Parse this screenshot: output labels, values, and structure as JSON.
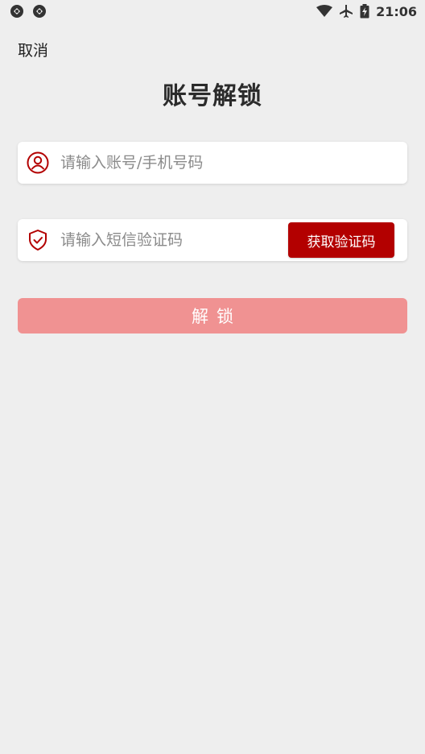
{
  "status_bar": {
    "time": "21:06",
    "icons": [
      "sync-icon",
      "sync-icon",
      "wifi-icon",
      "airplane-icon",
      "battery-icon"
    ]
  },
  "header": {
    "cancel_label": "取消",
    "title": "账号解锁"
  },
  "form": {
    "account": {
      "placeholder": "请输入账号/手机号码",
      "value": "",
      "icon": "user-icon"
    },
    "code": {
      "placeholder": "请输入短信验证码",
      "value": "",
      "icon": "shield-check-icon"
    },
    "get_code_label": "获取验证码",
    "submit_label": "解锁"
  },
  "colors": {
    "accent": "#b30000",
    "submit_disabled": "#f09292",
    "background": "#eeeeee"
  }
}
